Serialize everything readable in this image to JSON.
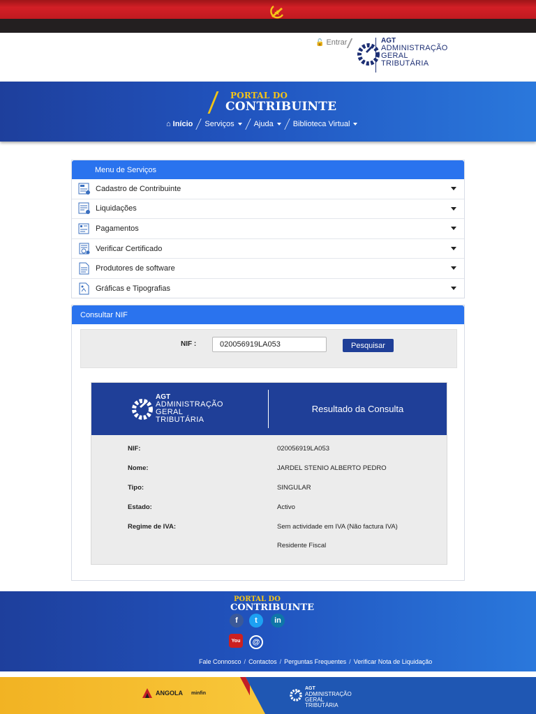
{
  "header": {
    "login_label": "Entrar",
    "agt_short": "AGT",
    "agt_line1": "ADMINISTRAÇÃO",
    "agt_line2": "GERAL",
    "agt_line3": "TRIBUTÁRIA"
  },
  "hero": {
    "portal_do": "PORTAL DO",
    "contribuinte": "CONTRIBUINTE",
    "nav": [
      {
        "label": "Início",
        "icon": "home-icon"
      },
      {
        "label": "Serviços",
        "icon": "caret-down-icon"
      },
      {
        "label": "Ajuda",
        "icon": "caret-down-icon"
      },
      {
        "label": "Biblioteca Virtual",
        "icon": "caret-down-icon"
      }
    ]
  },
  "menu": {
    "title": "Menu de Serviços",
    "items": [
      {
        "label": "Cadastro de Contribuinte",
        "icon": "registry-icon"
      },
      {
        "label": "Liquidações",
        "icon": "invoice-icon"
      },
      {
        "label": "Pagamentos",
        "icon": "payment-icon"
      },
      {
        "label": "Verificar Certificado",
        "icon": "certificate-icon"
      },
      {
        "label": "Produtores de software",
        "icon": "software-icon"
      },
      {
        "label": "Gráficas e Tipografias",
        "icon": "print-icon"
      }
    ]
  },
  "consulta": {
    "title": "Consultar NIF",
    "nif_label": "NIF :",
    "nif_value": "020056919LA053",
    "search_label": "Pesquisar"
  },
  "result": {
    "title": "Resultado da Consulta",
    "rows": [
      {
        "key": "NIF:",
        "value": "020056919LA053"
      },
      {
        "key": "Nome:",
        "value": "JARDEL STENIO ALBERTO PEDRO"
      },
      {
        "key": "Tipo:",
        "value": "SINGULAR"
      },
      {
        "key": "Estado:",
        "value": "Activo"
      },
      {
        "key": "Regime de IVA:",
        "value": "Sem actividade em IVA (Não factura IVA)"
      },
      {
        "key": "",
        "value": "Residente Fiscal"
      }
    ]
  },
  "footer": {
    "portal_do": "PORTAL DO",
    "contribuinte": "CONTRIBUINTE",
    "social": [
      {
        "label": "f",
        "icon": "facebook-icon",
        "color": "#3b5998"
      },
      {
        "label": "t",
        "icon": "twitter-icon",
        "color": "#1da1f2"
      },
      {
        "label": "in",
        "icon": "linkedin-icon",
        "color": "#0e76a8"
      },
      {
        "label": "You",
        "icon": "youtube-icon",
        "color": "#cd201f"
      },
      {
        "label": "@",
        "icon": "web-icon",
        "color": "#1f3f98"
      }
    ],
    "links": [
      "Fale Connosco",
      "Contactos",
      "Perguntas Frequentes",
      "Verificar Nota de Liquidação"
    ],
    "brand_angola": "ANGOLA",
    "brand_minfin": "minfin"
  }
}
